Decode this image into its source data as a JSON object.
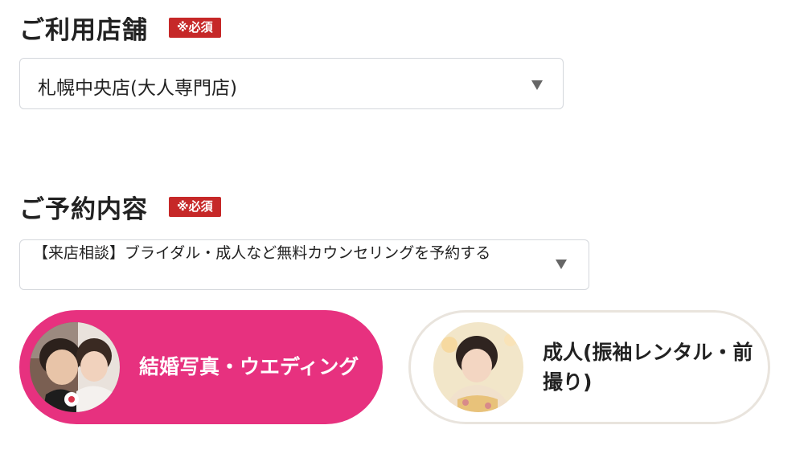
{
  "store_section": {
    "title": "ご利用店舗",
    "required_badge": "※必須",
    "select": {
      "value": "札幌中央店(大人専門店)",
      "icon": "caret-down-icon"
    }
  },
  "reservation_section": {
    "title": "ご予約内容",
    "required_badge": "※必須",
    "select": {
      "value": "【来店相談】ブライダル・成人など無料カウンセリングを予約する",
      "icon": "caret-down-icon"
    }
  },
  "categories": [
    {
      "label": "結婚写真・ウエディング",
      "image": "wedding-couple-photo",
      "selected": true,
      "color": "#e7317f"
    },
    {
      "label": "成人(振袖レンタル・前撮り)",
      "image": "furisode-portrait-photo",
      "selected": false,
      "color": "#ffffff"
    }
  ],
  "colors": {
    "badge": "#c62828",
    "accent": "#e7317f",
    "border": "#d4d7dc"
  }
}
